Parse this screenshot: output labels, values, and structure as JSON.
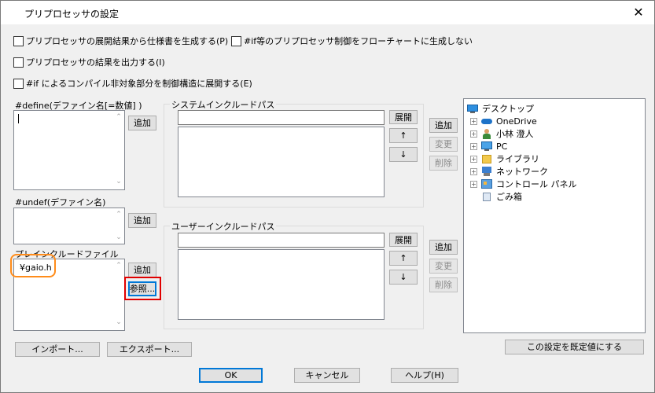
{
  "window": {
    "title": "プリプロセッサの設定"
  },
  "options": {
    "gen_spec": "プリプロセッサの展開結果から仕様書を生成する(P)",
    "no_flowchart": "#if等のプリプロセッサ制御をフローチャートに生成しない",
    "output_result": "プリプロセッサの結果を出力する(I)",
    "expand_if": "#if によるコンパイル非対象部分を制御構造に展開する(E)"
  },
  "define": {
    "label": "#define(デファイン名[=数値] )",
    "add": "追加"
  },
  "undef": {
    "label": "#undef(デファイン名)",
    "add": "追加"
  },
  "preinclude": {
    "label": "プレインクルードファイル",
    "items": [
      "¥gaio.h"
    ],
    "add": "追加",
    "browse": "参照..."
  },
  "sysinc": {
    "label": "システムインクルードパス",
    "expand": "展開",
    "up": "↑",
    "down": "↓",
    "add": "追加",
    "change": "変更",
    "delete": "削除"
  },
  "userinc": {
    "label": "ユーザーインクルードパス",
    "expand": "展開",
    "up": "↑",
    "down": "↓",
    "add": "追加",
    "change": "変更",
    "delete": "削除"
  },
  "tree": {
    "root": "デスクトップ",
    "items": [
      "OneDrive",
      "小林 澄人",
      "PC",
      "ライブラリ",
      "ネットワーク",
      "コントロール パネル",
      "ごみ箱"
    ]
  },
  "footer": {
    "import": "インポート...",
    "export": "エクスポート...",
    "set_default": "この設定を既定値にする",
    "ok": "OK",
    "cancel": "キャンセル",
    "help": "ヘルプ(H)"
  },
  "colors": {
    "highlight_red": "#e00000",
    "highlight_orange": "#ff8c1a",
    "accent": "#0078d7"
  }
}
